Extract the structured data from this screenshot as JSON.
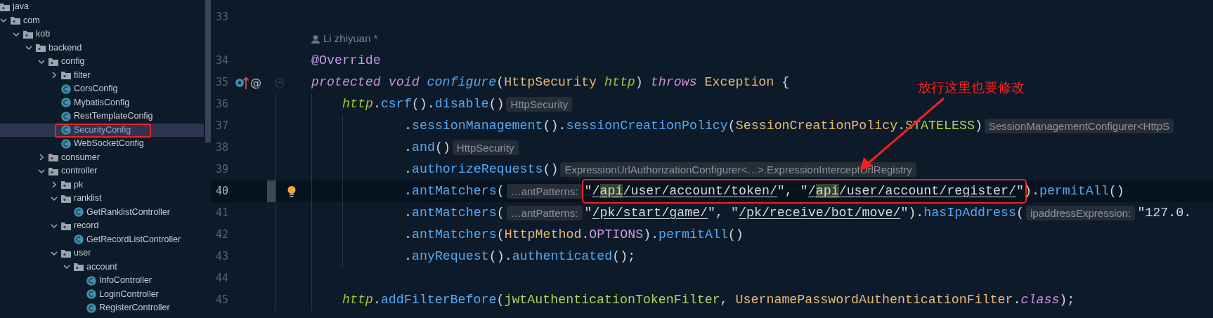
{
  "project_tree": {
    "items": [
      {
        "label": "java",
        "kind": "folder",
        "selected": false,
        "highlighted": false,
        "children": [
          {
            "label": "com",
            "kind": "folder",
            "expanded": true,
            "selected": false,
            "highlighted": false,
            "children": [
              {
                "label": "kob",
                "kind": "folder",
                "expanded": true,
                "selected": false,
                "highlighted": false,
                "children": [
                  {
                    "label": "backend",
                    "kind": "folder",
                    "expanded": true,
                    "selected": false,
                    "highlighted": false,
                    "children": [
                      {
                        "label": "config",
                        "kind": "folder",
                        "expanded": true,
                        "selected": false,
                        "highlighted": false,
                        "children": [
                          {
                            "label": "filter",
                            "kind": "folder",
                            "expanded": false,
                            "selected": false,
                            "highlighted": false
                          },
                          {
                            "label": "CorsConfig",
                            "kind": "class",
                            "selected": false,
                            "highlighted": false
                          },
                          {
                            "label": "MybatisConfig",
                            "kind": "class",
                            "selected": false,
                            "highlighted": false
                          },
                          {
                            "label": "RestTemplateConfig",
                            "kind": "class",
                            "selected": false,
                            "highlighted": false
                          },
                          {
                            "label": "SecurityConfig",
                            "kind": "class",
                            "selected": true,
                            "highlighted": true
                          },
                          {
                            "label": "WebSocketConfig",
                            "kind": "class",
                            "selected": false,
                            "highlighted": false
                          }
                        ]
                      },
                      {
                        "label": "consumer",
                        "kind": "folder",
                        "expanded": false,
                        "selected": false,
                        "highlighted": false
                      },
                      {
                        "label": "controller",
                        "kind": "folder",
                        "expanded": true,
                        "selected": false,
                        "highlighted": false,
                        "children": [
                          {
                            "label": "pk",
                            "kind": "folder",
                            "expanded": false,
                            "selected": false,
                            "highlighted": false
                          },
                          {
                            "label": "ranklist",
                            "kind": "folder",
                            "expanded": true,
                            "selected": false,
                            "highlighted": false,
                            "children": [
                              {
                                "label": "GetRanklistController",
                                "kind": "class",
                                "selected": false,
                                "highlighted": false
                              }
                            ]
                          },
                          {
                            "label": "record",
                            "kind": "folder",
                            "expanded": true,
                            "selected": false,
                            "highlighted": false,
                            "children": [
                              {
                                "label": "GetRecordListController",
                                "kind": "class",
                                "selected": false,
                                "highlighted": false
                              }
                            ]
                          },
                          {
                            "label": "user",
                            "kind": "folder",
                            "expanded": true,
                            "selected": false,
                            "highlighted": false,
                            "children": [
                              {
                                "label": "account",
                                "kind": "folder",
                                "expanded": true,
                                "selected": false,
                                "highlighted": false,
                                "children": [
                                  {
                                    "label": "InfoController",
                                    "kind": "class",
                                    "selected": false,
                                    "highlighted": false
                                  },
                                  {
                                    "label": "LoginController",
                                    "kind": "class",
                                    "selected": false,
                                    "highlighted": false
                                  },
                                  {
                                    "label": "RegisterController",
                                    "kind": "class",
                                    "selected": false,
                                    "highlighted": false
                                  }
                                ]
                              }
                            ]
                          }
                        ]
                      }
                    ]
                  }
                ]
              }
            ]
          }
        ]
      }
    ]
  },
  "editor": {
    "lines": [
      {
        "number": "33"
      },
      {
        "kind": "author",
        "text": "Li zhiyuan *"
      },
      {
        "number": "34",
        "tokens": [
          {
            "kind": "annotation",
            "text": "@Override"
          }
        ]
      },
      {
        "number": "35",
        "fold_start": true,
        "override_marker": true,
        "gutter_text": "@",
        "tokens": [
          {
            "kind": "keyword",
            "text": "protected "
          },
          {
            "kind": "keyword",
            "text": "void "
          },
          {
            "kind": "declaration",
            "text": "configure"
          },
          {
            "kind": "plain",
            "text": "("
          },
          {
            "kind": "type",
            "text": "HttpSecurity "
          },
          {
            "kind": "param",
            "text": "http"
          },
          {
            "kind": "plain",
            "text": ") "
          },
          {
            "kind": "keyword",
            "text": "throws "
          },
          {
            "kind": "type",
            "text": "Exception "
          },
          {
            "kind": "plain",
            "text": "{"
          }
        ],
        "children": [
          {
            "number": "36",
            "tokens": [
              {
                "kind": "param",
                "text": "http"
              },
              {
                "kind": "plain",
                "text": "."
              },
              {
                "kind": "method",
                "text": "csrf"
              },
              {
                "kind": "plain",
                "text": "()."
              },
              {
                "kind": "method",
                "text": "disable"
              },
              {
                "kind": "plain",
                "text": "()"
              },
              {
                "kind": "hint",
                "text": "HttpSecurity"
              }
            ],
            "children": [
              {
                "number": "37",
                "tokens": [
                  {
                    "kind": "plain",
                    "text": "."
                  },
                  {
                    "kind": "method",
                    "text": "sessionManagement"
                  },
                  {
                    "kind": "plain",
                    "text": "()."
                  },
                  {
                    "kind": "method",
                    "text": "sessionCreationPolicy"
                  },
                  {
                    "kind": "plain",
                    "text": "("
                  },
                  {
                    "kind": "type",
                    "text": "SessionCreationPolicy"
                  },
                  {
                    "kind": "plain",
                    "text": "."
                  },
                  {
                    "kind": "field",
                    "text": "STATELESS"
                  },
                  {
                    "kind": "plain",
                    "text": ")"
                  },
                  {
                    "kind": "hint",
                    "text": "SessionManagementConfigurer<HttpS"
                  }
                ]
              },
              {
                "number": "38",
                "tokens": [
                  {
                    "kind": "plain",
                    "text": "."
                  },
                  {
                    "kind": "method",
                    "text": "and"
                  },
                  {
                    "kind": "plain",
                    "text": "()"
                  },
                  {
                    "kind": "hint",
                    "text": "HttpSecurity"
                  }
                ]
              },
              {
                "number": "39",
                "tokens": [
                  {
                    "kind": "plain",
                    "text": "."
                  },
                  {
                    "kind": "method",
                    "text": "authorizeRequests"
                  },
                  {
                    "kind": "plain",
                    "text": "()"
                  },
                  {
                    "kind": "hint",
                    "text": "ExpressionUrlAuthorizationConfigurer<…>.ExpressionInterceptUrlRegistry"
                  }
                ]
              },
              {
                "number": "40",
                "current": true,
                "changed": true,
                "lightbulb": true,
                "tokens": [
                  {
                    "kind": "plain",
                    "text": "."
                  },
                  {
                    "kind": "method",
                    "text": "antMatchers"
                  },
                  {
                    "kind": "plain",
                    "text": "("
                  },
                  {
                    "kind": "hint",
                    "text": "…antPatterns:"
                  },
                  {
                    "kind": "group",
                    "boxed": true,
                    "tokens": [
                      {
                        "kind": "string",
                        "text": "\""
                      },
                      {
                        "kind": "path",
                        "text": "/"
                      },
                      {
                        "kind": "match",
                        "text": "api"
                      },
                      {
                        "kind": "path",
                        "text": "/user/account/token/"
                      },
                      {
                        "kind": "string",
                        "text": "\", \""
                      },
                      {
                        "kind": "path",
                        "text": "/"
                      },
                      {
                        "kind": "match",
                        "text": "api"
                      },
                      {
                        "kind": "path",
                        "text": "/user/account/register/"
                      },
                      {
                        "kind": "string",
                        "text": "\""
                      }
                    ]
                  },
                  {
                    "kind": "plain",
                    "text": ")."
                  },
                  {
                    "kind": "method",
                    "text": "permitAll"
                  },
                  {
                    "kind": "plain",
                    "text": "()"
                  }
                ]
              },
              {
                "number": "41",
                "tokens": [
                  {
                    "kind": "plain",
                    "text": "."
                  },
                  {
                    "kind": "method",
                    "text": "antMatchers"
                  },
                  {
                    "kind": "plain",
                    "text": "("
                  },
                  {
                    "kind": "hint",
                    "text": "…antPatterns:"
                  },
                  {
                    "kind": "string",
                    "text": "\""
                  },
                  {
                    "kind": "path",
                    "text": "/pk/start/game/"
                  },
                  {
                    "kind": "string",
                    "text": "\", \""
                  },
                  {
                    "kind": "path",
                    "text": "/pk/receive/bot/move/"
                  },
                  {
                    "kind": "string",
                    "text": "\""
                  },
                  {
                    "kind": "plain",
                    "text": ")."
                  },
                  {
                    "kind": "method",
                    "text": "hasIpAddress"
                  },
                  {
                    "kind": "plain",
                    "text": "("
                  },
                  {
                    "kind": "hint",
                    "text": "ipaddressExpression:"
                  },
                  {
                    "kind": "string",
                    "text": "\"127.0."
                  }
                ]
              },
              {
                "number": "42",
                "tokens": [
                  {
                    "kind": "plain",
                    "text": "."
                  },
                  {
                    "kind": "method",
                    "text": "antMatchers"
                  },
                  {
                    "kind": "plain",
                    "text": "("
                  },
                  {
                    "kind": "type",
                    "text": "HttpMethod"
                  },
                  {
                    "kind": "plain",
                    "text": "."
                  },
                  {
                    "kind": "enum",
                    "text": "OPTIONS"
                  },
                  {
                    "kind": "plain",
                    "text": ")."
                  },
                  {
                    "kind": "method",
                    "text": "permitAll"
                  },
                  {
                    "kind": "plain",
                    "text": "()"
                  }
                ]
              },
              {
                "number": "43",
                "tokens": [
                  {
                    "kind": "plain",
                    "text": "."
                  },
                  {
                    "kind": "method",
                    "text": "anyRequest"
                  },
                  {
                    "kind": "plain",
                    "text": "()."
                  },
                  {
                    "kind": "method",
                    "text": "authenticated"
                  },
                  {
                    "kind": "plain",
                    "text": "();"
                  }
                ]
              }
            ]
          },
          {
            "number": "44"
          },
          {
            "number": "45",
            "tokens": [
              {
                "kind": "param",
                "text": "http"
              },
              {
                "kind": "plain",
                "text": "."
              },
              {
                "kind": "method",
                "text": "addFilterBefore"
              },
              {
                "kind": "plain",
                "text": "("
              },
              {
                "kind": "field",
                "text": "jwtAuthenticationTokenFilter"
              },
              {
                "kind": "plain",
                "text": ", "
              },
              {
                "kind": "type",
                "text": "UsernamePasswordAuthenticationFilter"
              },
              {
                "kind": "plain",
                "text": "."
              },
              {
                "kind": "keyword",
                "text": "class"
              },
              {
                "kind": "plain",
                "text": ");"
              }
            ]
          }
        ]
      }
    ]
  },
  "annotation": {
    "text": "放行这里也要修改"
  }
}
